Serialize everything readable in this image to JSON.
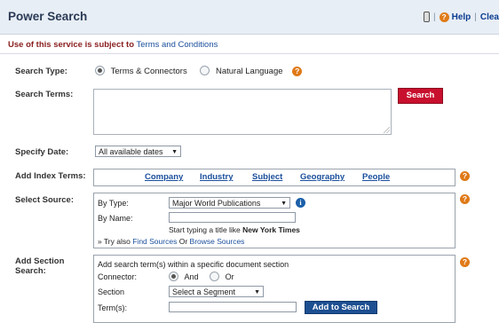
{
  "header": {
    "title": "Power Search",
    "help_label": "Help",
    "clear_label": "Clea"
  },
  "notice": {
    "prefix": "Use of this service is subject to",
    "link": "Terms and Conditions"
  },
  "search_type": {
    "label": "Search Type:",
    "options": [
      "Terms & Connectors",
      "Natural Language"
    ],
    "selected": "Terms & Connectors"
  },
  "search_terms": {
    "label": "Search Terms:",
    "value": "",
    "button": "Search"
  },
  "specify_date": {
    "label": "Specify Date:",
    "value": "All available dates"
  },
  "index_terms": {
    "label": "Add Index Terms:",
    "links": [
      "Company",
      "Industry",
      "Subject",
      "Geography",
      "People"
    ]
  },
  "source": {
    "label": "Select Source:",
    "by_type_label": "By Type:",
    "by_type_value": "Major World Publications",
    "by_name_label": "By Name:",
    "by_name_value": "",
    "hint_prefix": "Start typing a title like",
    "hint_example": "New York Times",
    "try_prefix": "» Try also",
    "find_sources": "Find Sources",
    "or_text": "Or",
    "browse_sources": "Browse Sources"
  },
  "section": {
    "label_line1": "Add Section",
    "label_line2": "Search:",
    "intro": "Add search term(s) within a specific document section",
    "connector_label": "Connector:",
    "connector_options": [
      "And",
      "Or"
    ],
    "connector_selected": "And",
    "section_label": "Section",
    "section_value": "Select a Segment",
    "terms_label": "Term(s):",
    "terms_value": "",
    "button": "Add to Search"
  },
  "icons": {
    "help": "question-icon",
    "info": "info-icon",
    "tool": "toolbox-icon"
  },
  "colors": {
    "header_bg": "#e8eef5",
    "search_button": "#c8102e",
    "add_button": "#1d4f91",
    "help_icon": "#e07a18"
  }
}
